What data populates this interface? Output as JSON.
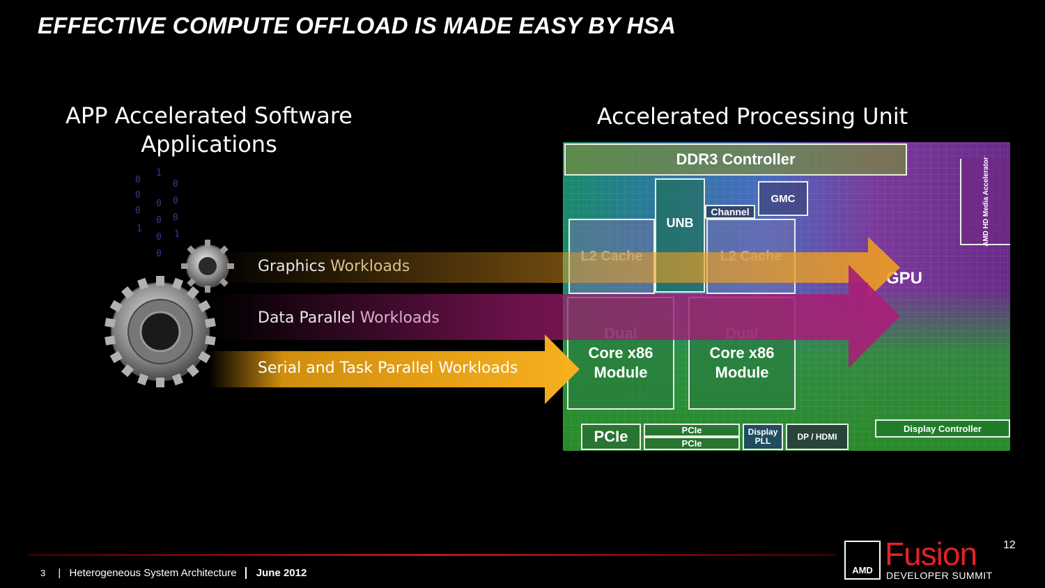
{
  "slide": {
    "title": "EFFECTIVE COMPUTE OFFLOAD IS MADE EASY BY HSA",
    "left_heading_line1": "APP Accelerated Software",
    "left_heading_line2": "Applications",
    "right_heading": "Accelerated Processing Unit"
  },
  "die": {
    "ddr3": "DDR3 Controller",
    "unb": "UNB",
    "channel": "Channel",
    "gmc": "GMC",
    "l2_left": "L2 Cache",
    "l2_right": "L2 Cache",
    "core_left": {
      "dual": "Dual",
      "line1": "Core x86",
      "line2": "Module"
    },
    "core_right": {
      "dual": "Dual",
      "line1": "Core x86",
      "line2": "Module"
    },
    "media": "AMD HD Media Accelerator",
    "gpu": "GPU",
    "pcie_big": "PCIe",
    "pcie_small_1": "PCIe",
    "pcie_small_2": "PCIe",
    "display_pll_1": "Display",
    "display_pll_2": "PLL",
    "dp_hdmi": "DP / HDMI",
    "display_controller": "Display Controller"
  },
  "arrows": {
    "graphics_a": "Graphics",
    "graphics_b": "Workloads",
    "data_a": "Data Parallel",
    "data_b": "Workloads",
    "serial": "Serial and Task Parallel Workloads"
  },
  "footer": {
    "page": "3",
    "divider": "|",
    "section": "Heterogeneous System Architecture",
    "date": "June 2012"
  },
  "logo": {
    "amd": "AMD",
    "fusion": "Fusion",
    "superscript": "12",
    "summit": "DEVELOPER SUMMIT"
  },
  "colors": {
    "graphics_arrow": "#f0a020",
    "data_arrow": "#9a1a6a",
    "serial_arrow": "#f5a810",
    "footer_line": "#c01818",
    "fusion_red": "#e32228"
  }
}
